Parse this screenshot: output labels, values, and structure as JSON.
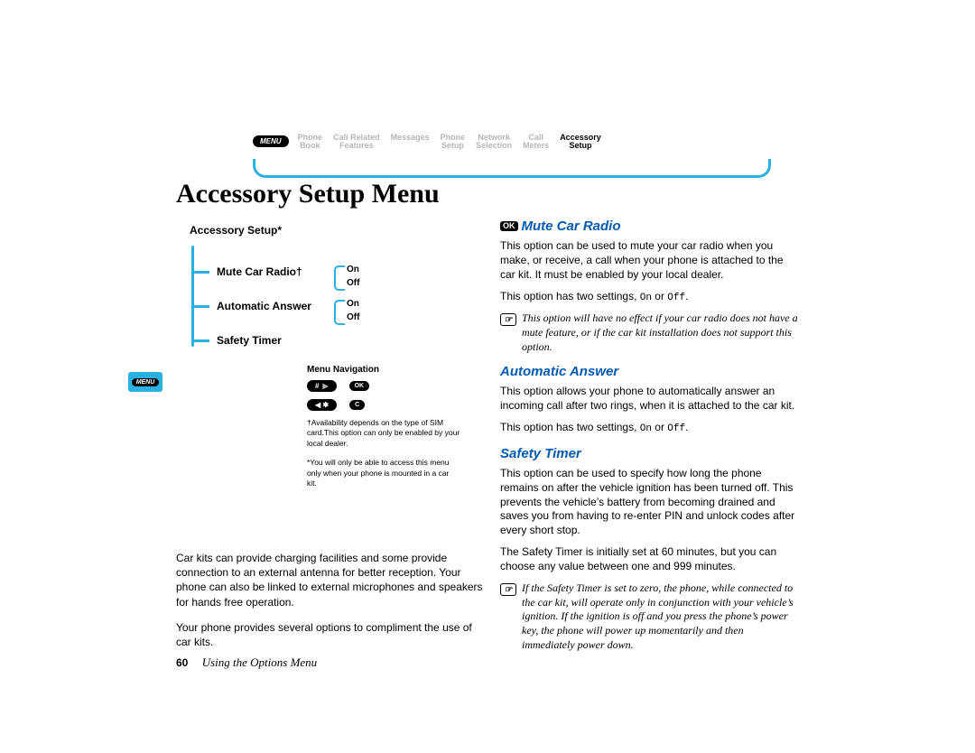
{
  "nav": {
    "menu_label": "MENU",
    "items": [
      {
        "l1": "Phone",
        "l2": "Book"
      },
      {
        "l1": "Call Related",
        "l2": "Features"
      },
      {
        "l1": "Messages",
        "l2": ""
      },
      {
        "l1": "Phone",
        "l2": "Setup"
      },
      {
        "l1": "Network",
        "l2": "Selection"
      },
      {
        "l1": "Call",
        "l2": "Meters"
      },
      {
        "l1": "Accessory",
        "l2": "Setup"
      }
    ]
  },
  "heading": "Accessory Setup Menu",
  "side_tab": "MENU",
  "tree": {
    "title": "Accessory Setup*",
    "items": [
      "Mute Car Radio†",
      "Automatic Answer",
      "Safety Timer"
    ],
    "opts": {
      "on": "On",
      "off": "Off"
    },
    "menu_nav": "Menu Navigation",
    "pill_hash": "#",
    "pill_arrows": "◀  ✱",
    "pill_ok": "OK",
    "pill_c": "C",
    "fn_dagger": "†Availability depends on the type of SIM card.This option can only be enabled by your local dealer.",
    "fn_star": "*You will only be able to access this menu only when your phone is mounted in a car kit."
  },
  "left_body": {
    "p1": "Car kits can provide charging facilities and some provide connection to an external antenna for better reception. Your phone can also be linked to external microphones and speakers for hands free operation.",
    "p2": "Your phone provides several options to compliment the use of car kits."
  },
  "footer": {
    "page": "60",
    "chapter": "Using the Options Menu"
  },
  "right": {
    "s1_head": "Mute Car Radio",
    "ok": "OK",
    "s1_p1": "This option can be used to mute your car radio when you make, or receive, a call when your phone is attached to the car kit. It must be enabled by your local dealer.",
    "s1_p2a": "This option has two settings, ",
    "s1_on": "On",
    "s1_or": " or ",
    "s1_off": "Off",
    "s1_dot": ".",
    "s1_note": "This option will have no effect if your car radio does not have a mute feature, or if the car kit installation does not support this option.",
    "s2_head": "Automatic Answer",
    "s2_p1": "This option allows your phone to automatically answer an incoming call after two rings, when it is attached to the car kit.",
    "s2_p2a": "This option has two settings, ",
    "s3_head": "Safety Timer",
    "s3_p1": "This option can be used to specify how long the phone remains on after the vehicle ignition has been turned off. This prevents the vehicle’s battery from becoming drained and saves you from having to re-enter PIN and unlock codes after every short stop.",
    "s3_p2": "The Safety Timer is initially set at 60 minutes, but you can choose any value between one and 999 minutes.",
    "s3_note": "If the Safety Timer is set to zero, the phone, while connected to the car kit, will operate only in conjunction with your vehicle’s ignition. If the ignition is off and you press the phone’s power key, the phone will power up momentarily and then immediately power down."
  }
}
